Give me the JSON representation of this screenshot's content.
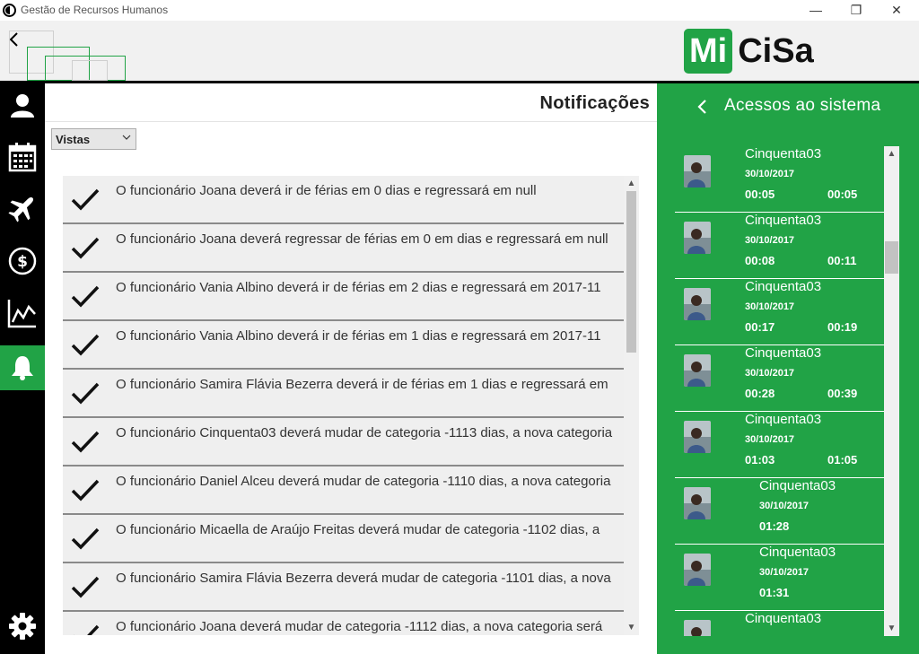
{
  "window": {
    "title": "Gestão de Recursos Humanos",
    "minimize": "—",
    "restore": "❐",
    "close": "✕"
  },
  "header": {
    "logo_box": "Mi",
    "logo_rest": "CiSa"
  },
  "sidebar": {
    "items": [
      {
        "icon": "user-icon",
        "active": false
      },
      {
        "icon": "calendar-icon",
        "active": false
      },
      {
        "icon": "airplane-icon",
        "active": false
      },
      {
        "icon": "dollar-icon",
        "active": false
      },
      {
        "icon": "chart-icon",
        "active": false
      },
      {
        "icon": "bell-icon",
        "active": true
      }
    ],
    "settings_icon": "gear-icon"
  },
  "main": {
    "title": "Notificações",
    "filter": {
      "selected": "Vistas"
    },
    "notifications": [
      "O funcionário Joana   deverá ir de férias em 0 dias e regressará em null",
      "O funcionário Joana   deverá regressar de férias em 0 em dias e regressará em null",
      "O funcionário Vania Albino   deverá ir de férias em 2 dias e regressará em 2017-11",
      "O funcionário Vania Albino   deverá ir de férias em 1 dias e regressará em 2017-11",
      "O funcionário Samira Flávia Bezerra   deverá ir de férias em 1 dias e regressará em",
      "O funcionário Cinquenta03   deverá mudar de categoria  -1113 dias, a nova categoria",
      "O funcionário Daniel Alceu   deverá mudar de categoria  -1110 dias, a nova categoria",
      "O funcionário Micaella de Araújo Freitas   deverá mudar de categoria  -1102 dias, a",
      "O funcionário Samira Flávia Bezerra   deverá mudar de categoria  -1101 dias, a nova",
      "O funcionário Joana   deverá mudar de categoria  -1112 dias, a nova categoria será"
    ]
  },
  "panel": {
    "title": "Acessos ao sistema",
    "accesses": [
      {
        "name": "Cinquenta03",
        "date": "30/10/2017",
        "in": "00:05",
        "out": "00:05"
      },
      {
        "name": "Cinquenta03",
        "date": "30/10/2017",
        "in": "00:08",
        "out": "00:11"
      },
      {
        "name": "Cinquenta03",
        "date": "30/10/2017",
        "in": "00:17",
        "out": "00:19"
      },
      {
        "name": "Cinquenta03",
        "date": "30/10/2017",
        "in": "00:28",
        "out": "00:39"
      },
      {
        "name": "Cinquenta03",
        "date": "30/10/2017",
        "in": "01:03",
        "out": "01:05"
      },
      {
        "name": "Cinquenta03",
        "date": "30/10/2017",
        "in": "01:28",
        "out": ""
      },
      {
        "name": "Cinquenta03",
        "date": "30/10/2017",
        "in": "01:31",
        "out": ""
      },
      {
        "name": "Cinquenta03",
        "date": "",
        "in": "",
        "out": ""
      }
    ]
  },
  "colors": {
    "accent": "#21a346",
    "sidebar": "#000000"
  }
}
